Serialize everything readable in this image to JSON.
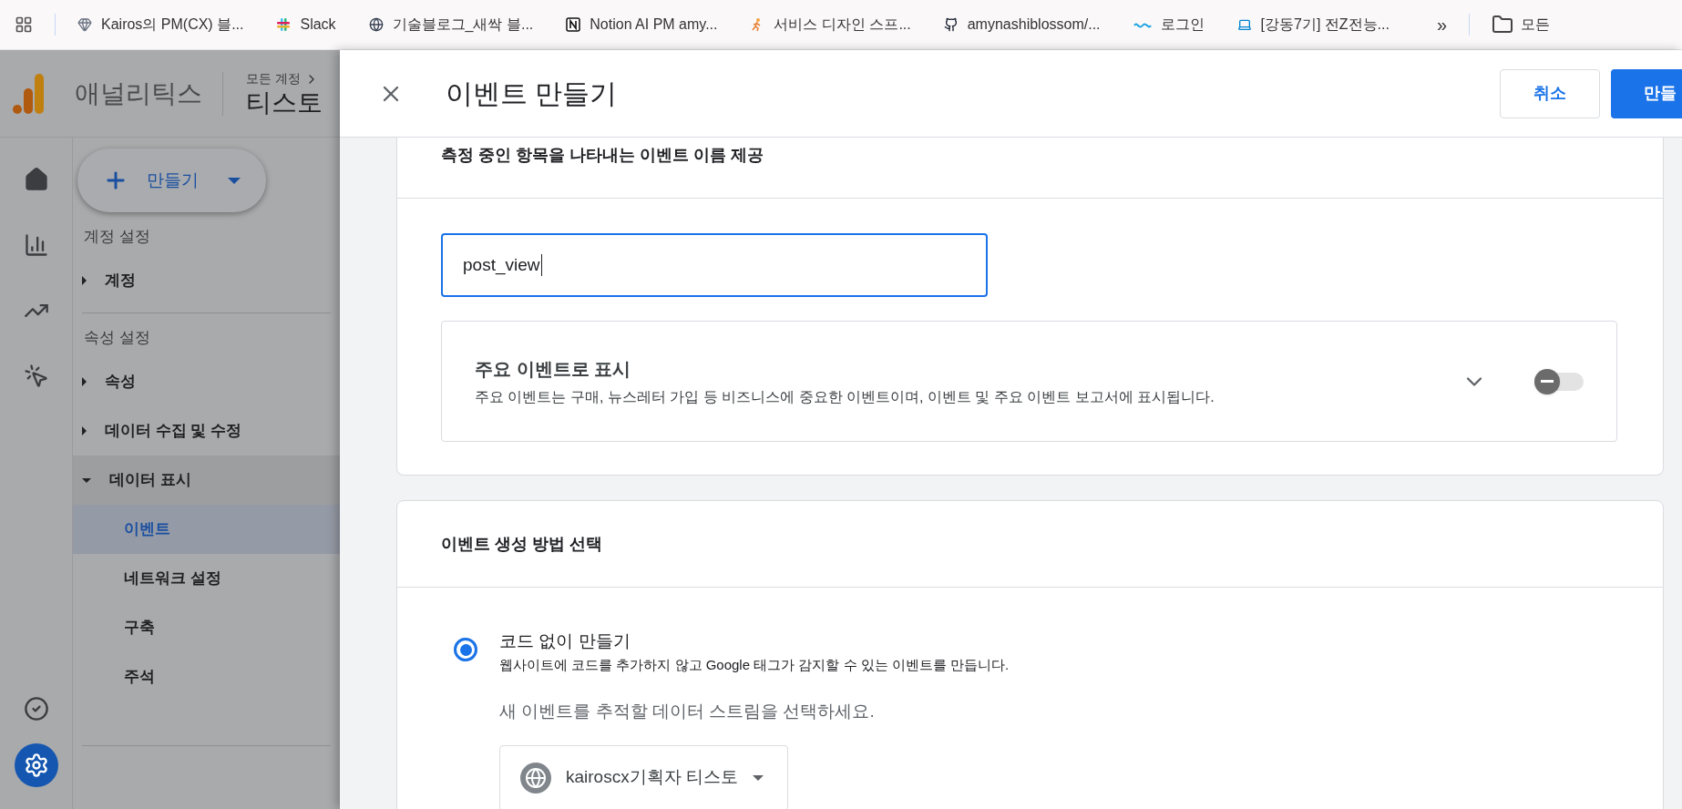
{
  "bookmarks": [
    {
      "kind": "gem",
      "label": "Kairos의 PM(CX) 블..."
    },
    {
      "kind": "slack",
      "label": "Slack"
    },
    {
      "kind": "globe",
      "label": "기술블로그_새싹 블..."
    },
    {
      "kind": "notion",
      "label": "Notion AI PM amy..."
    },
    {
      "kind": "runner",
      "label": "서비스 디자인 스프..."
    },
    {
      "kind": "github",
      "label": "amynashiblossom/..."
    },
    {
      "kind": "sba",
      "label": "로그인"
    },
    {
      "kind": "laptop",
      "label": "[강동7기] 전Z전능..."
    }
  ],
  "bookmarks_more": "»",
  "bookmarks_folder": "모든",
  "app": {
    "name": "애널리틱스",
    "breadcrumb": "모든 계정",
    "property": "티스토"
  },
  "rail": [
    {
      "kind": "home",
      "selected": false
    },
    {
      "kind": "reports",
      "selected": false
    },
    {
      "kind": "explore",
      "selected": false
    },
    {
      "kind": "advertising",
      "selected": false
    }
  ],
  "rail_bottom": [
    {
      "kind": "check",
      "selected": false
    },
    {
      "kind": "admin",
      "selected": true
    }
  ],
  "create_button": "만들기",
  "nav": [
    {
      "heading": "계정 설정",
      "items": [
        {
          "label": "계정",
          "expanded": false
        }
      ]
    },
    {
      "heading": "속성 설정",
      "items": [
        {
          "label": "속성",
          "expanded": false
        },
        {
          "label": "데이터 수집 및 수정",
          "expanded": false
        },
        {
          "label": "데이터 표시",
          "expanded": true,
          "children": [
            {
              "label": "이벤트",
              "selected": true
            },
            {
              "label": "네트워크 설정",
              "selected": false
            },
            {
              "label": "구축",
              "selected": false
            },
            {
              "label": "주석",
              "selected": false
            }
          ]
        }
      ]
    }
  ],
  "panel": {
    "title": "이벤트 만들기",
    "cancel": "취소",
    "create": "만들",
    "name_card": {
      "title": "측정 중인 항목을 나타내는 이벤트 이름 제공",
      "value": "post_view",
      "key_event": {
        "title": "주요 이벤트로 표시",
        "description": "주요 이벤트는 구매, 뉴스레터 가입 등 비즈니스에 중요한 이벤트이며, 이벤트 및 주요 이벤트 보고서에 표시됩니다.",
        "expanded": false,
        "on": false
      }
    },
    "method_card": {
      "title": "이벤트 생성 방법 선택",
      "options": [
        {
          "label": "코드 없이 만들기",
          "description": "웹사이트에 코드를 추가하지 않고 Google 태그가 감지할 수 있는 이벤트를 만듭니다.",
          "selected": true
        }
      ],
      "stream_prompt": "새 이벤트를 추적할 데이터 스트림을 선택하세요.",
      "stream": "kairoscx기획자 티스토"
    }
  }
}
